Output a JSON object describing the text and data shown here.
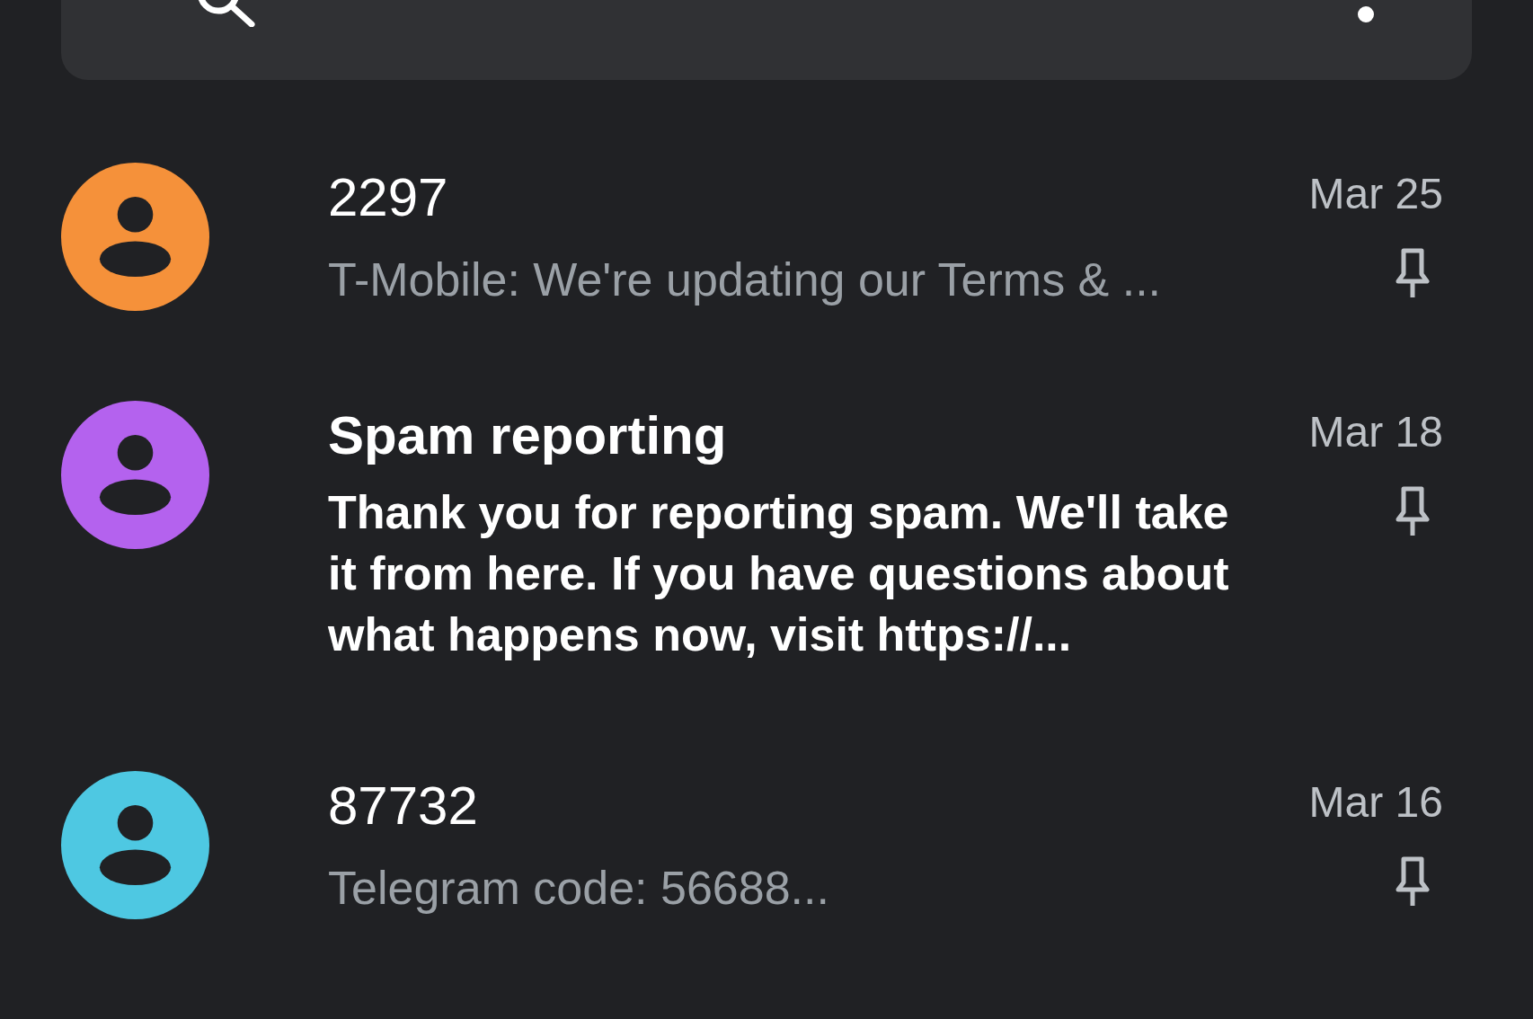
{
  "conversations": [
    {
      "name": "2297",
      "snippet": "T-Mobile: We're updating our Terms & ...",
      "date": "Mar 25",
      "unread": false,
      "color": "#f5913a"
    },
    {
      "name": "Spam reporting",
      "snippet": "Thank you for reporting spam. We'll take it from here. If you have questions about what happens now, visit https://...",
      "date": "Mar 18",
      "unread": true,
      "color": "#b462ee"
    },
    {
      "name": "87732",
      "snippet": "Telegram code: 56688...",
      "date": "Mar 16",
      "unread": false,
      "color": "#4ec8e2"
    }
  ]
}
